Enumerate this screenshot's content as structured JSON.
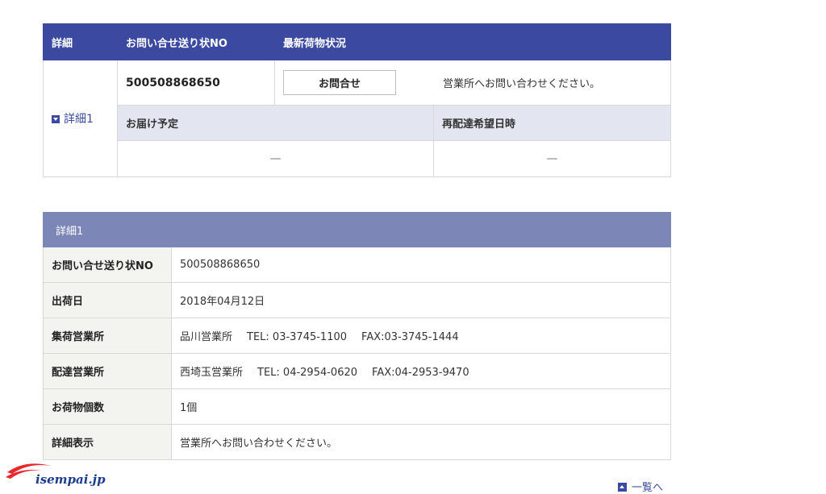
{
  "summary": {
    "headers": [
      "詳細",
      "お問い合せ送り状NO",
      "最新荷物状況"
    ],
    "detail_link": "詳細1",
    "tracking_no": "500508868650",
    "inquire_button": "お問合せ",
    "status_message": "営業所へお問い合わせください。",
    "sub_headers": [
      "お届け予定",
      "再配達希望日時"
    ],
    "sub_values": [
      "—",
      "—"
    ]
  },
  "detail": {
    "caption": "詳細1",
    "rows": [
      {
        "label": "お問い合せ送り状NO",
        "value": "500508868650"
      },
      {
        "label": "出荷日",
        "value": "2018年04月12日"
      },
      {
        "label": "集荷営業所",
        "value": "品川営業所",
        "tel": "TEL: 03-3745-1100",
        "fax": "FAX:03-3745-1444"
      },
      {
        "label": "配達営業所",
        "value": "西埼玉営業所",
        "tel": "TEL: 04-2954-0620",
        "fax": "FAX:04-2953-9470"
      },
      {
        "label": "お荷物個数",
        "value": "1個"
      },
      {
        "label": "詳細表示",
        "value": "営業所へお問い合わせください。"
      }
    ]
  },
  "footer": {
    "back_to_list": "一覧へ",
    "logo_text": "isempai.jp"
  },
  "colors": {
    "header_bg": "#3b4aa0",
    "sub_header_bg": "#e3e5f0",
    "caption_bg": "#7c87b8"
  },
  "icons": [
    "expand-detail-icon",
    "back-to-list-icon",
    "isempai-logo"
  ]
}
